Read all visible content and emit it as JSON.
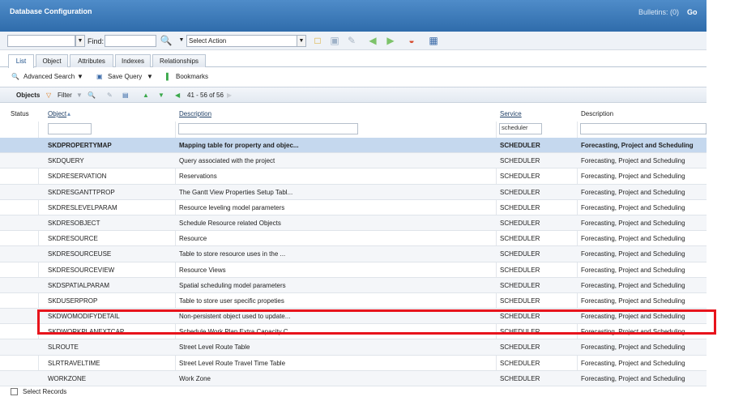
{
  "titlebar": {
    "title": "Database Configuration",
    "bulletins": "Bulletins: (0)",
    "goto": "Go"
  },
  "toolbar": {
    "find_label": "Find:",
    "select_action": "Select Action"
  },
  "tabs": [
    {
      "label": "List"
    },
    {
      "label": "Object"
    },
    {
      "label": "Attributes"
    },
    {
      "label": "Indexes"
    },
    {
      "label": "Relationships"
    }
  ],
  "actions": {
    "advanced_search": "Advanced Search",
    "save_query": "Save Query",
    "bookmarks": "Bookmarks"
  },
  "tablebar": {
    "title": "Objects",
    "filter": "Filter",
    "pagination": "41 - 56 of 56"
  },
  "columns": {
    "status": "Status",
    "object": "Object",
    "description": "Description",
    "service": "Service",
    "service_description": "Description"
  },
  "filters": {
    "object": "",
    "description": "",
    "service": "scheduler",
    "service_description": ""
  },
  "rows": [
    {
      "object": "SKDPROPERTYMAP",
      "description": "Mapping table for property and objec...",
      "service": "SCHEDULER",
      "service_description": "Forecasting, Project and Scheduling"
    },
    {
      "object": "SKDQUERY",
      "description": "Query associated with the project",
      "service": "SCHEDULER",
      "service_description": "Forecasting, Project and Scheduling"
    },
    {
      "object": "SKDRESERVATION",
      "description": "Reservations",
      "service": "SCHEDULER",
      "service_description": "Forecasting, Project and Scheduling"
    },
    {
      "object": "SKDRESGANTTPROP",
      "description": "The Gantt View Properties Setup Tabl...",
      "service": "SCHEDULER",
      "service_description": "Forecasting, Project and Scheduling"
    },
    {
      "object": "SKDRESLEVELPARAM",
      "description": "Resource leveling model parameters",
      "service": "SCHEDULER",
      "service_description": "Forecasting, Project and Scheduling"
    },
    {
      "object": "SKDRESOBJECT",
      "description": "Schedule Resource related Objects",
      "service": "SCHEDULER",
      "service_description": "Forecasting, Project and Scheduling"
    },
    {
      "object": "SKDRESOURCE",
      "description": "Resource",
      "service": "SCHEDULER",
      "service_description": "Forecasting, Project and Scheduling"
    },
    {
      "object": "SKDRESOURCEUSE",
      "description": "Table to store resource uses in the ...",
      "service": "SCHEDULER",
      "service_description": "Forecasting, Project and Scheduling"
    },
    {
      "object": "SKDRESOURCEVIEW",
      "description": "Resource Views",
      "service": "SCHEDULER",
      "service_description": "Forecasting, Project and Scheduling"
    },
    {
      "object": "SKDSPATIALPARAM",
      "description": "Spatial scheduling model parameters",
      "service": "SCHEDULER",
      "service_description": "Forecasting, Project and Scheduling"
    },
    {
      "object": "SKDUSERPROP",
      "description": "Table to store user specific propeties",
      "service": "SCHEDULER",
      "service_description": "Forecasting, Project and Scheduling"
    },
    {
      "object": "SKDWOMODIFYDETAIL",
      "description": "Non-persistent object used to update...",
      "service": "SCHEDULER",
      "service_description": "Forecasting, Project and Scheduling"
    },
    {
      "object": "SKDWORKPLANEXTCAP",
      "description": "Schedule Work Plan Extra Capacity C...",
      "service": "SCHEDULER",
      "service_description": "Forecasting, Project and Scheduling"
    },
    {
      "object": "SLROUTE",
      "description": "Street Level Route Table",
      "service": "SCHEDULER",
      "service_description": "Forecasting, Project and Scheduling"
    },
    {
      "object": "SLRTRAVELTIME",
      "description": "Street Level Route Travel Time Table",
      "service": "SCHEDULER",
      "service_description": "Forecasting, Project and Scheduling"
    },
    {
      "object": "WORKZONE",
      "description": "Work Zone",
      "service": "SCHEDULER",
      "service_description": "Forecasting, Project and Scheduling"
    }
  ],
  "footer": {
    "select_records": "Select Records"
  },
  "colors": {
    "titlebar": "#3c7bbd",
    "selected_row": "#c5d8ee",
    "highlight": "#e8141c"
  }
}
